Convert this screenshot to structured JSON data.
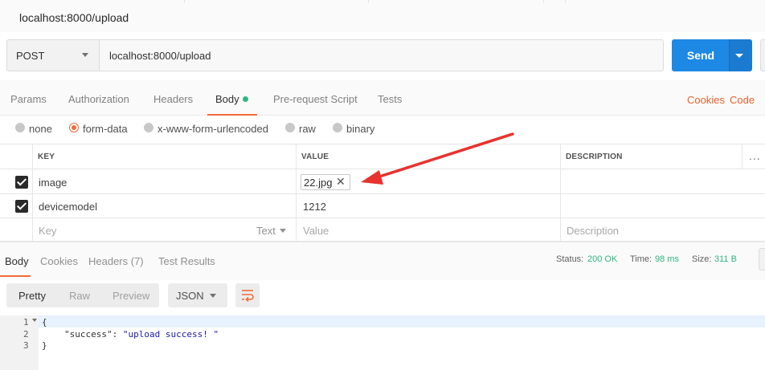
{
  "window": {
    "title": "localhost:8000/upload"
  },
  "request": {
    "method": "POST",
    "url": "localhost:8000/upload",
    "send_label": "Send"
  },
  "request_tabs": [
    {
      "label": "Params"
    },
    {
      "label": "Authorization"
    },
    {
      "label": "Headers"
    },
    {
      "label": "Body",
      "active": true
    },
    {
      "label": "Pre-request Script"
    },
    {
      "label": "Tests"
    }
  ],
  "request_links": {
    "cookies": "Cookies",
    "code": "Code"
  },
  "body_types": [
    {
      "label": "none"
    },
    {
      "label": "form-data",
      "selected": true
    },
    {
      "label": "x-www-form-urlencoded"
    },
    {
      "label": "raw"
    },
    {
      "label": "binary"
    }
  ],
  "params_table": {
    "headers": {
      "key": "KEY",
      "value": "VALUE",
      "description": "DESCRIPTION"
    },
    "more_icon": "...",
    "rows": [
      {
        "checked": true,
        "key": "image",
        "value": "22.jpg",
        "value_type": "file",
        "remove_icon": "✕"
      },
      {
        "checked": true,
        "key": "devicemodel",
        "value": "1212"
      }
    ],
    "new_row": {
      "key_placeholder": "Key",
      "type_label": "Text",
      "value_placeholder": "Value",
      "description_placeholder": "Description"
    }
  },
  "response_tabs": [
    {
      "label": "Body",
      "active": true
    },
    {
      "label": "Cookies"
    },
    {
      "label": "Headers (7)"
    },
    {
      "label": "Test Results"
    }
  ],
  "response_status": {
    "status_label": "Status:",
    "status_value": "200 OK",
    "time_label": "Time:",
    "time_value": "98 ms",
    "size_label": "Size:",
    "size_value": "311 B",
    "value_color": "#2fb582"
  },
  "response_format": {
    "modes": [
      {
        "label": "Pretty",
        "active": true
      },
      {
        "label": "Raw"
      },
      {
        "label": "Preview"
      }
    ],
    "language": "JSON",
    "wrap_icon": "wrap-lines-icon"
  },
  "response_code": {
    "line_numbers": [
      "1",
      "2",
      "3"
    ],
    "open_brace": "{",
    "key": "\"success\"",
    "colon": ": ",
    "value": "\"upload success! \"",
    "close_brace": "}"
  },
  "colors": {
    "accent": "#f26b3a",
    "send": "#1e88e5",
    "body_dot": "#2fb582",
    "annotation_arrow": "#e8322e"
  }
}
